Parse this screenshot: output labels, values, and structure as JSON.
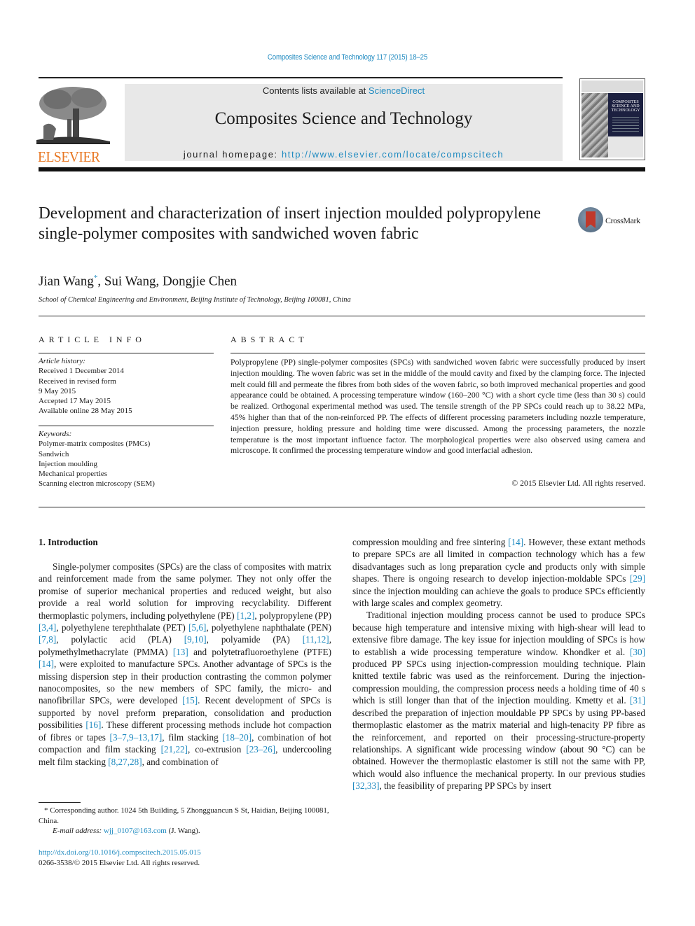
{
  "running_head": "Composites Science and Technology 117 (2015) 18–25",
  "header": {
    "publisher_logo": "ELSEVIER",
    "contents_prefix": "Contents lists available at ",
    "contents_link": "ScienceDirect",
    "journal_title": "Composites Science and Technology",
    "homepage_prefix": "journal homepage: ",
    "homepage_link": "http://www.elsevier.com/locate/compscitech",
    "cover_title": "COMPOSITES SCIENCE AND TECHNOLOGY"
  },
  "article": {
    "title": "Development and characterization of insert injection moulded polypropylene single-polymer composites with sandwiched woven fabric",
    "crossmark_label": "CrossMark",
    "authors_line1": "Jian Wang",
    "author_mark": "*",
    "authors_line2": ", Sui Wang, Dongjie Chen",
    "affiliation": "School of Chemical Engineering and Environment, Beijing Institute of Technology, Beijing 100081, China"
  },
  "article_info": {
    "heading": "ARTICLE INFO",
    "history_label": "Article history:",
    "history": [
      "Received 1 December 2014",
      "Received in revised form",
      "9 May 2015",
      "Accepted 17 May 2015",
      "Available online 28 May 2015"
    ],
    "keywords_label": "Keywords:",
    "keywords": [
      "Polymer-matrix composites (PMCs)",
      "Sandwich",
      "Injection moulding",
      "Mechanical properties",
      "Scanning electron microscopy (SEM)"
    ]
  },
  "abstract": {
    "heading": "ABSTRACT",
    "text": "Polypropylene (PP) single-polymer composites (SPCs) with sandwiched woven fabric were successfully produced by insert injection moulding. The woven fabric was set in the middle of the mould cavity and fixed by the clamping force. The injected melt could fill and permeate the fibres from both sides of the woven fabric, so both improved mechanical properties and good appearance could be obtained. A processing temperature window (160–200 °C) with a short cycle time (less than 30 s) could be realized. Orthogonal experimental method was used. The tensile strength of the PP SPCs could reach up to 38.22 MPa, 45% higher than that of the non-reinforced PP. The effects of different processing parameters including nozzle temperature, injection pressure, holding pressure and holding time were discussed. Among the processing parameters, the nozzle temperature is the most important influence factor. The morphological properties were also observed using camera and microscope. It confirmed the processing temperature window and good interfacial adhesion.",
    "copyright": "© 2015 Elsevier Ltd. All rights reserved."
  },
  "intro": {
    "heading": "1.  Introduction",
    "left_p1": [
      {
        "t": "Single-polymer composites (SPCs) are the class of composites with matrix and reinforcement made from the same polymer. They not only offer the promise of superior mechanical properties and reduced weight, but also provide a real world solution for improving recyclability. Different thermoplastic polymers, including polyethylene (PE) "
      },
      {
        "ref": "[1,2]"
      },
      {
        "t": ", polypropylene (PP) "
      },
      {
        "ref": "[3,4]"
      },
      {
        "t": ", polyethylene terephthalate (PET) "
      },
      {
        "ref": "[5,6]"
      },
      {
        "t": ", polyethylene naphthalate (PEN) "
      },
      {
        "ref": "[7,8]"
      },
      {
        "t": ", polylactic acid (PLA) "
      },
      {
        "ref": "[9,10]"
      },
      {
        "t": ", polyamide (PA) "
      },
      {
        "ref": "[11,12]"
      },
      {
        "t": ", polymethylmethacrylate (PMMA) "
      },
      {
        "ref": "[13]"
      },
      {
        "t": " and polytetrafluoroethylene (PTFE) "
      },
      {
        "ref": "[14]"
      },
      {
        "t": ", were exploited to manufacture SPCs. Another advantage of SPCs is the missing dispersion step in their production contrasting the common polymer nanocomposites, so the new members of SPC family, the micro- and nanofibrillar SPCs, were developed "
      },
      {
        "ref": "[15]"
      },
      {
        "t": ". Recent development of SPCs is supported by novel preform preparation, consolidation and production possibilities "
      },
      {
        "ref": "[16]"
      },
      {
        "t": ". These different processing methods include hot compaction of fibres or tapes "
      },
      {
        "ref": "[3–7,9–13,17]"
      },
      {
        "t": ", film stacking "
      },
      {
        "ref": "[18–20]"
      },
      {
        "t": ", combination of hot compaction and film stacking "
      },
      {
        "ref": "[21,22]"
      },
      {
        "t": ", co-extrusion "
      },
      {
        "ref": "[23–26]"
      },
      {
        "t": ", undercooling melt film stacking "
      },
      {
        "ref": "[8,27,28]"
      },
      {
        "t": ", and combination of"
      }
    ],
    "right_p1": [
      {
        "t": "compression moulding and free sintering "
      },
      {
        "ref": "[14]"
      },
      {
        "t": ". However, these extant methods to prepare SPCs are all limited in compaction technology which has a few disadvantages such as long preparation cycle and products only with simple shapes. There is ongoing research to develop injection-moldable SPCs "
      },
      {
        "ref": "[29]"
      },
      {
        "t": " since the injection moulding can achieve the goals to produce SPCs efficiently with large scales and complex geometry."
      }
    ],
    "right_p2": [
      {
        "t": "Traditional injection moulding process cannot be used to produce SPCs because high temperature and intensive mixing with high-shear will lead to extensive fibre damage. The key issue for injection moulding of SPCs is how to establish a wide processing temperature window. Khondker et al. "
      },
      {
        "ref": "[30]"
      },
      {
        "t": " produced PP SPCs using injection-compression moulding technique. Plain knitted textile fabric was used as the reinforcement. During the injection-compression moulding, the compression process needs a holding time of 40 s which is still longer than that of the injection moulding. Kmetty et al. "
      },
      {
        "ref": "[31]"
      },
      {
        "t": " described the preparation of injection mouldable PP SPCs by using PP-based thermoplastic elastomer as the matrix material and high-tenacity PP fibre as the reinforcement, and reported on their processing-structure-property relationships. A significant wide processing window (about 90 °C) can be obtained. However the thermoplastic elastomer is still not the same with PP, which would also influence the mechanical property. In our previous studies "
      },
      {
        "ref": "[32,33]"
      },
      {
        "t": ", the feasibility of preparing PP SPCs by insert"
      }
    ]
  },
  "footnote": {
    "star_line": "* Corresponding author. 1024 5th Building, 5 Zhongguancun S St, Haidian, Beijing 100081, China.",
    "email_label": "E-mail address: ",
    "email": "wjj_0107@163.com",
    "email_suffix": " (J. Wang)."
  },
  "doi": {
    "link": "http://dx.doi.org/10.1016/j.compscitech.2015.05.015",
    "issn_line": "0266-3538/© 2015 Elsevier Ltd. All rights reserved."
  },
  "colors": {
    "link": "#1f8ac0",
    "elsevier_orange": "#e87722",
    "header_box": "#e8e8e8"
  }
}
